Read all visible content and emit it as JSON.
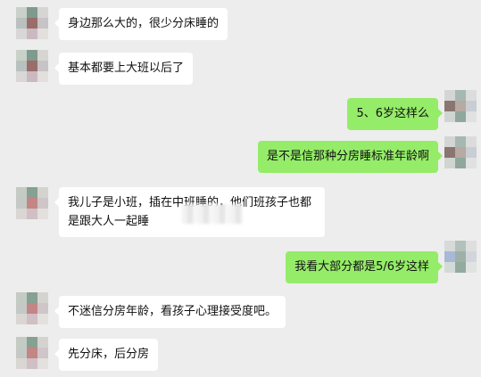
{
  "messages": [
    {
      "side": "left",
      "text": "身边那么大的，很少分床睡的"
    },
    {
      "side": "left",
      "text": "基本都要上大班以后了"
    },
    {
      "side": "right",
      "text": "5、6岁这样么"
    },
    {
      "side": "right",
      "text": "是不是信那种分房睡标准年龄啊"
    },
    {
      "side": "left",
      "text": "我儿子是小班，插在中班睡的，他们班孩子也都是跟大人一起睡"
    },
    {
      "side": "right",
      "text": "我看大部分都是5/6岁这样"
    },
    {
      "side": "left",
      "text": "不迷信分房年龄，看孩子心理接受度吧。"
    },
    {
      "side": "left",
      "text": "先分床，后分房"
    }
  ]
}
